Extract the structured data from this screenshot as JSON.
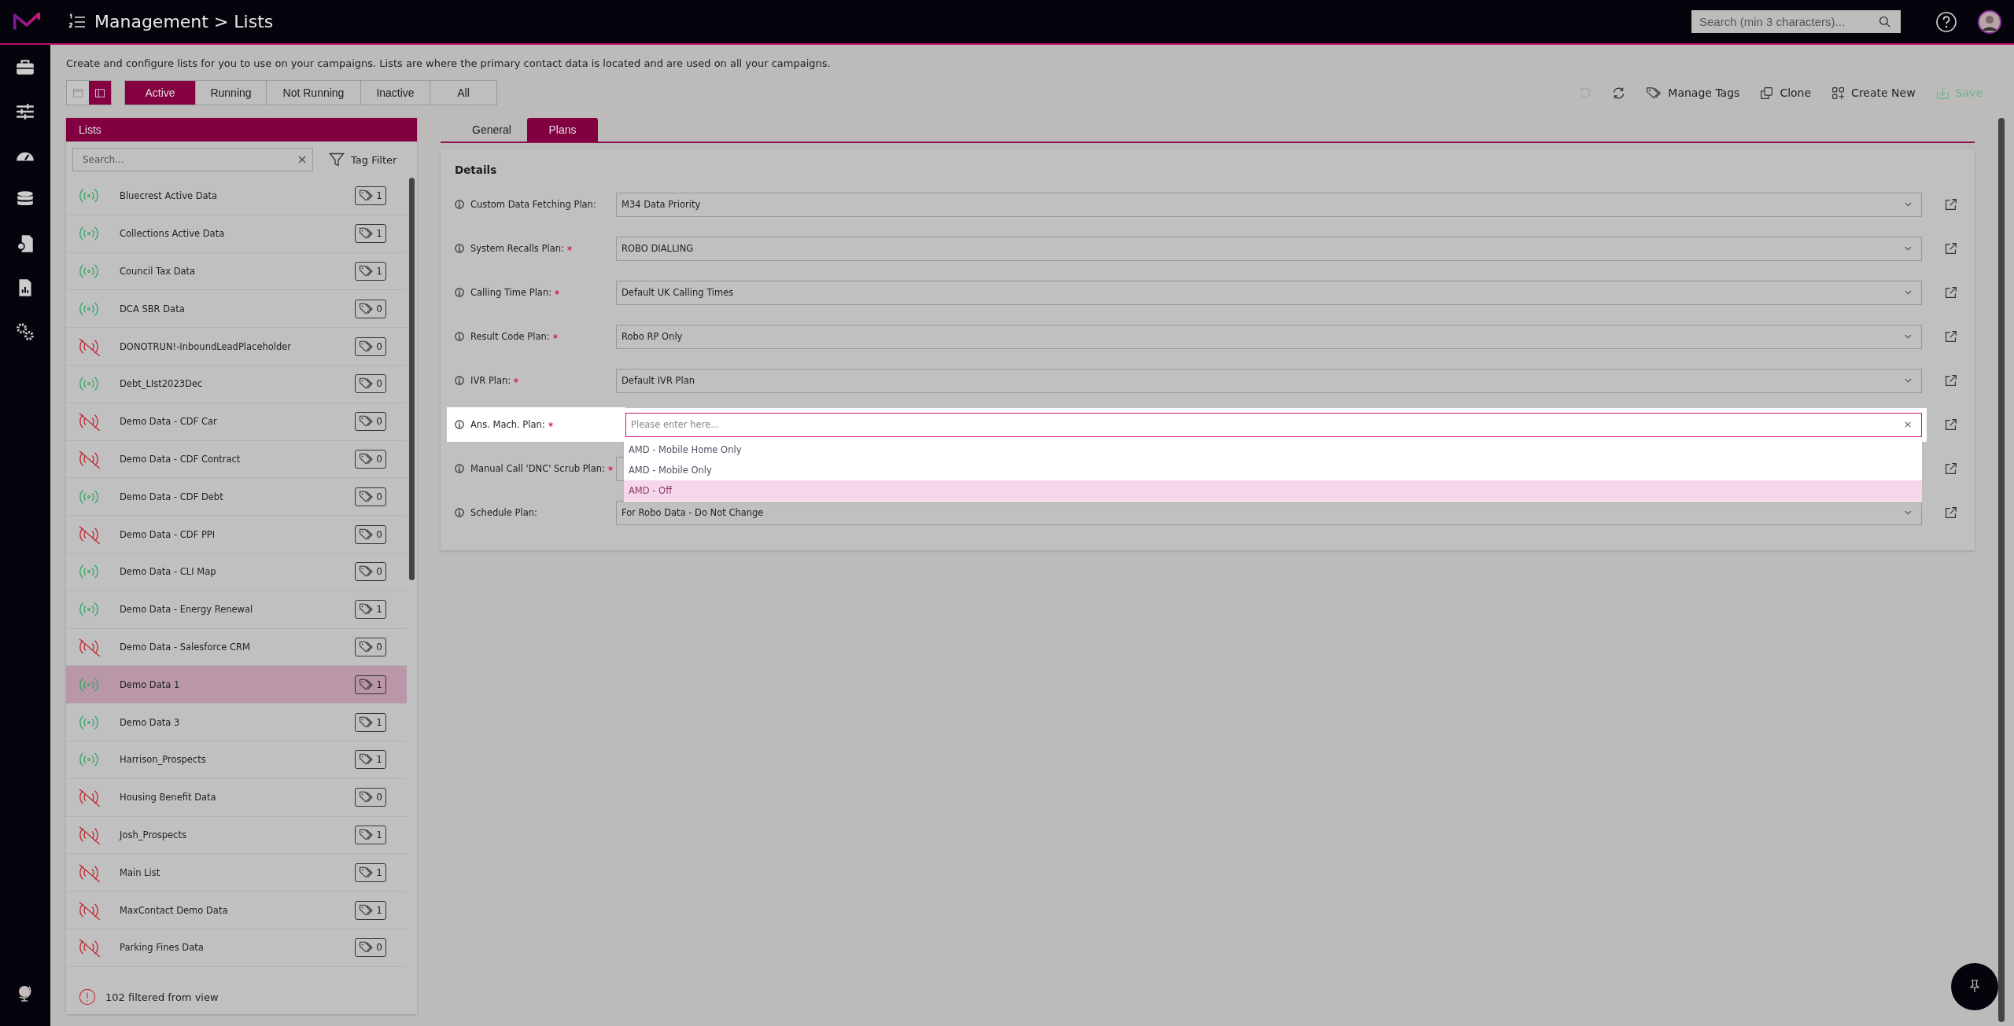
{
  "header": {
    "breadcrumb": "Management > Lists",
    "search_placeholder": "Search (min 3 characters)..."
  },
  "description": "Create and configure lists for you to use on your campaigns. Lists are where the primary contact data is located and are used on all your campaigns.",
  "view_toggle": [
    {
      "kind": "single",
      "selected": false
    },
    {
      "kind": "split",
      "selected": true
    }
  ],
  "filters": [
    {
      "label": "Active",
      "selected": true
    },
    {
      "label": "Running",
      "selected": false
    },
    {
      "label": "Not Running",
      "selected": false
    },
    {
      "label": "Inactive",
      "selected": false
    },
    {
      "label": "All",
      "selected": false
    }
  ],
  "toolbar": [
    {
      "kind": "undo",
      "disabled": true
    },
    {
      "kind": "refresh",
      "disabled": false
    },
    {
      "kind": "tags",
      "label": "Manage Tags",
      "disabled": false
    },
    {
      "kind": "clone",
      "label": "Clone",
      "disabled": false
    },
    {
      "kind": "create",
      "label": "Create New",
      "disabled": false
    },
    {
      "kind": "save",
      "label": "Save",
      "disabled": true
    }
  ],
  "lists_panel": {
    "title": "Lists",
    "search_placeholder": "Search...",
    "tag_filter": "Tag Filter",
    "footer": "102 filtered from view",
    "items": [
      {
        "name": "Bluecrest Active Data",
        "running": true,
        "tags": "1",
        "selected": false
      },
      {
        "name": "Collections Active Data",
        "running": true,
        "tags": "1",
        "selected": false
      },
      {
        "name": "Council Tax Data",
        "running": true,
        "tags": "1",
        "selected": false
      },
      {
        "name": "DCA SBR Data",
        "running": true,
        "tags": "0",
        "selected": false
      },
      {
        "name": "DONOTRUN!-InboundLeadPlaceholder",
        "running": false,
        "tags": "0",
        "selected": false
      },
      {
        "name": "Debt_LIst2023Dec",
        "running": true,
        "tags": "0",
        "selected": false
      },
      {
        "name": "Demo Data - CDF Car",
        "running": false,
        "tags": "0",
        "selected": false
      },
      {
        "name": "Demo Data - CDF Contract",
        "running": false,
        "tags": "0",
        "selected": false
      },
      {
        "name": "Demo Data - CDF Debt",
        "running": true,
        "tags": "0",
        "selected": false
      },
      {
        "name": "Demo Data - CDF PPI",
        "running": false,
        "tags": "0",
        "selected": false
      },
      {
        "name": "Demo Data - CLI Map",
        "running": true,
        "tags": "0",
        "selected": false
      },
      {
        "name": "Demo Data - Energy Renewal",
        "running": true,
        "tags": "1",
        "selected": false
      },
      {
        "name": "Demo Data - Salesforce CRM",
        "running": false,
        "tags": "0",
        "selected": false
      },
      {
        "name": "Demo Data 1",
        "running": true,
        "tags": "1",
        "selected": true
      },
      {
        "name": "Demo Data 3",
        "running": true,
        "tags": "1",
        "selected": false
      },
      {
        "name": "Harrison_Prospects",
        "running": true,
        "tags": "1",
        "selected": false
      },
      {
        "name": "Housing Benefit Data",
        "running": false,
        "tags": "0",
        "selected": false
      },
      {
        "name": "Josh_Prospects",
        "running": false,
        "tags": "1",
        "selected": false
      },
      {
        "name": "Main List",
        "running": false,
        "tags": "1",
        "selected": false
      },
      {
        "name": "MaxContact Demo Data",
        "running": false,
        "tags": "1",
        "selected": false
      },
      {
        "name": "Parking Fines Data",
        "running": false,
        "tags": "0",
        "selected": false
      }
    ]
  },
  "tabs": [
    {
      "label": "General",
      "selected": false
    },
    {
      "label": "Plans",
      "selected": true
    }
  ],
  "details": {
    "title": "Details",
    "fields": [
      {
        "label": "Custom Data Fetching Plan:",
        "required": false,
        "open": false,
        "value": "M34 Data Priority"
      },
      {
        "label": "System Recalls Plan:",
        "required": true,
        "open": false,
        "value": "ROBO DIALLING"
      },
      {
        "label": "Calling Time Plan:",
        "required": true,
        "open": false,
        "value": "Default UK Calling Times"
      },
      {
        "label": "Result Code Plan:",
        "required": true,
        "open": false,
        "value": "Robo RP Only"
      },
      {
        "label": "IVR Plan:",
        "required": true,
        "open": false,
        "value": "Default IVR Plan"
      },
      {
        "label": "Ans. Mach. Plan:",
        "required": true,
        "open": true,
        "placeholder": "Please enter here...",
        "options": [
          {
            "label": "AMD - Mobile Home Only",
            "selected": false
          },
          {
            "label": "AMD - Mobile Only",
            "selected": false
          },
          {
            "label": "AMD - Off",
            "selected": true
          }
        ]
      },
      {
        "label": "Manual Call 'DNC' Scrub Plan:",
        "required": true,
        "open": false
      },
      {
        "label": "Schedule Plan:",
        "required": false,
        "open": false,
        "value": "For Robo Data - Do Not Change"
      }
    ]
  }
}
